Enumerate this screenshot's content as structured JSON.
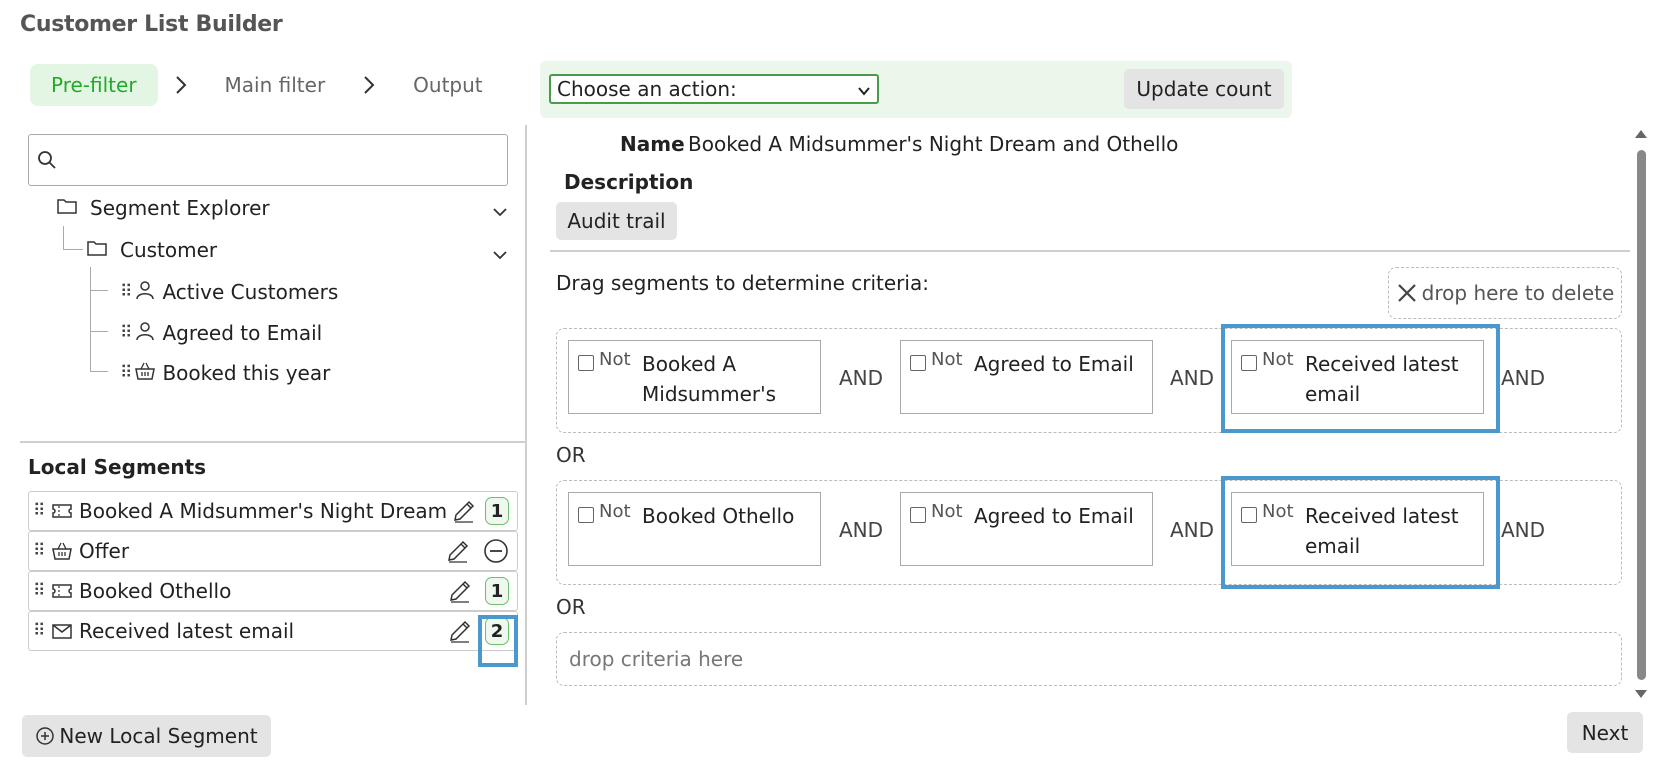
{
  "app": {
    "title": "Customer List Builder"
  },
  "steps": [
    {
      "label": "Pre-filter",
      "active": true
    },
    {
      "label": "Main filter",
      "active": false
    },
    {
      "label": "Output",
      "active": false
    }
  ],
  "actionbar": {
    "select_value": "Choose an action:",
    "update_label": "Update count"
  },
  "tree": {
    "root": "Segment Explorer",
    "customer": "Customer",
    "items": [
      "Active Customers",
      "Agreed to Email",
      "Booked this year"
    ]
  },
  "local_segments": {
    "title": "Local Segments",
    "items": [
      {
        "label": "Booked A Midsummer's Night Dream",
        "icon": "ticket-icon",
        "badge": "1"
      },
      {
        "label": "Offer",
        "icon": "basket-icon",
        "badge": null
      },
      {
        "label": "Booked Othello",
        "icon": "ticket-icon",
        "badge": "1"
      },
      {
        "label": "Received latest email",
        "icon": "envelope-icon",
        "badge": "2"
      }
    ],
    "new_label": "New Local Segment"
  },
  "detail": {
    "name_label": "Name",
    "name_value": "Booked A Midsummer's Night Dream and Othello",
    "description_label": "Description",
    "audit_label": "Audit trail",
    "drag_hint": "Drag segments to determine criteria:",
    "delete_zone": "drop here to delete",
    "groups": [
      {
        "criteria": [
          "Booked A Midsummer's",
          "Agreed to Email",
          "Received latest email"
        ]
      },
      {
        "criteria": [
          "Booked Othello",
          "Agreed to Email",
          "Received latest email"
        ]
      }
    ],
    "not_label": "Not",
    "and_label": "AND",
    "or_label": "OR",
    "drop_criteria": "drop criteria here",
    "next_label": "Next"
  },
  "colors": {
    "accent_green": "#22aa2a",
    "highlight_blue": "#4a98cc"
  }
}
